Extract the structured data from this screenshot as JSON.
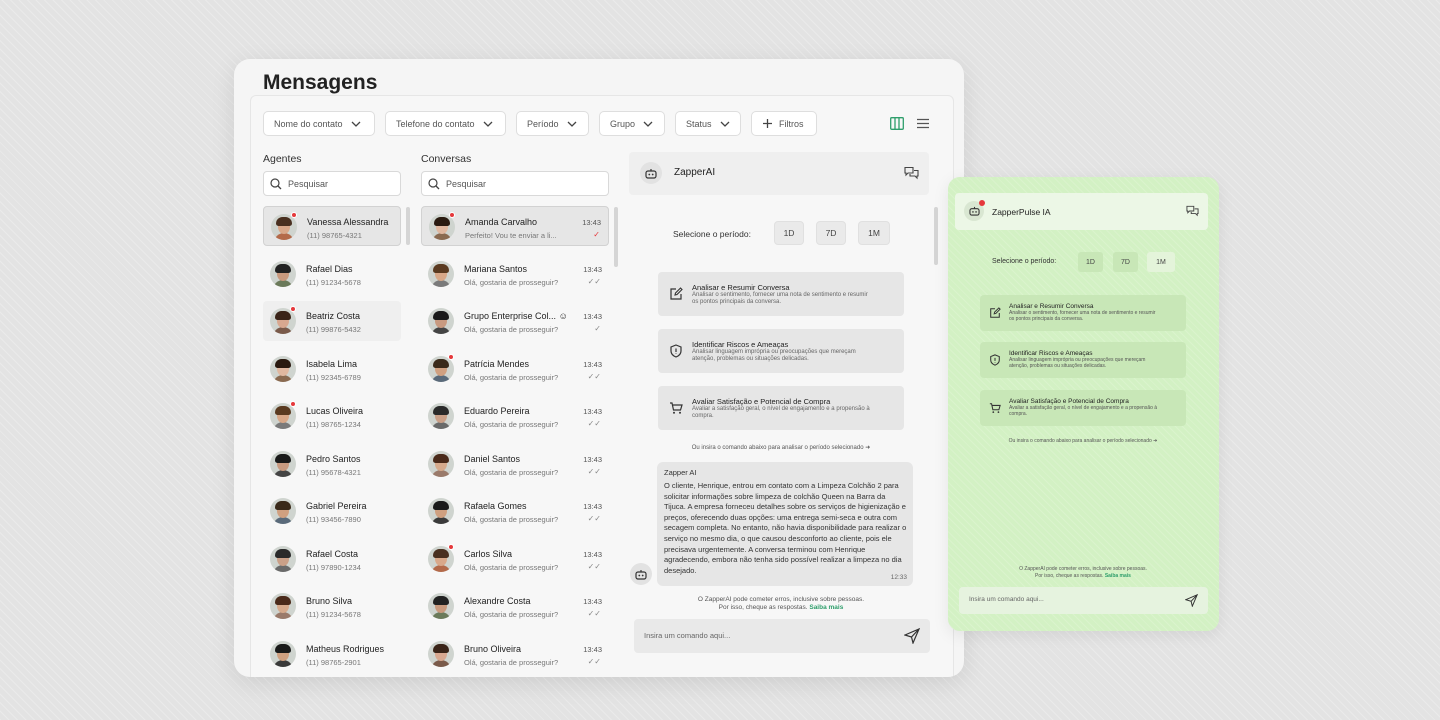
{
  "page_title": "Mensagens",
  "filters": [
    {
      "label": "Nome do contato"
    },
    {
      "label": "Telefone do contato"
    },
    {
      "label": "Período"
    },
    {
      "label": "Grupo"
    },
    {
      "label": "Status"
    }
  ],
  "filters_button": "Filtros",
  "agents": {
    "title": "Agentes",
    "search_placeholder": "Pesquisar",
    "items": [
      {
        "name": "Vanessa Alessandra",
        "phone": "(11) 98765-4321"
      },
      {
        "name": "Rafael Dias",
        "phone": "(11) 91234-5678"
      },
      {
        "name": "Beatriz Costa",
        "phone": "(11) 99876-5432"
      },
      {
        "name": "Isabela Lima",
        "phone": "(11) 92345-6789"
      },
      {
        "name": "Lucas Oliveira",
        "phone": "(11) 98765-1234"
      },
      {
        "name": "Pedro Santos",
        "phone": "(11) 95678-4321"
      },
      {
        "name": "Gabriel Pereira",
        "phone": "(11) 93456-7890"
      },
      {
        "name": "Rafael Costa",
        "phone": "(11) 97890-1234"
      },
      {
        "name": "Bruno Silva",
        "phone": "(11) 91234-5678"
      },
      {
        "name": "Matheus Rodrigues",
        "phone": "(11) 98765-2901"
      }
    ]
  },
  "conversations": {
    "title": "Conversas",
    "search_placeholder": "Pesquisar",
    "items": [
      {
        "name": "Amanda Carvalho",
        "preview": "Perfeito! Vou te enviar a li...",
        "time": "13:43"
      },
      {
        "name": "Mariana Santos",
        "preview": "Olá, gostaria de prosseguir?",
        "time": "13:43"
      },
      {
        "name": "Grupo Enterprise Col...",
        "preview": "Olá, gostaria de prosseguir?",
        "time": "13:43"
      },
      {
        "name": "Patrícia Mendes",
        "preview": "Olá, gostaria de prosseguir?",
        "time": "13:43"
      },
      {
        "name": "Eduardo Pereira",
        "preview": "Olá, gostaria de prosseguir?",
        "time": "13:43"
      },
      {
        "name": "Daniel Santos",
        "preview": "Olá, gostaria de prosseguir?",
        "time": "13:43"
      },
      {
        "name": "Rafaela Gomes",
        "preview": "Olá, gostaria de prosseguir?",
        "time": "13:43"
      },
      {
        "name": "Carlos Silva",
        "preview": "Olá, gostaria de prosseguir?",
        "time": "13:43"
      },
      {
        "name": "Alexandre Costa",
        "preview": "Olá, gostaria de prosseguir?",
        "time": "13:43"
      },
      {
        "name": "Bruno Oliveira",
        "preview": "Olá, gostaria de prosseguir?",
        "time": "13:43"
      }
    ]
  },
  "chat": {
    "title": "ZapperAI",
    "period_label": "Selecione o período:",
    "periods": [
      "1D",
      "7D",
      "1M"
    ],
    "actions": [
      {
        "title": "Analisar e Resumir Conversa",
        "desc": "Analisar o sentimento, fornecer uma nota de sentimento e resumir os pontos principais da conversa.",
        "icon": "edit-icon"
      },
      {
        "title": "Identificar Riscos e Ameaças",
        "desc": "Analisar linguagem imprópria ou preocupações que mereçam atenção, problemas ou situações delicadas.",
        "icon": "shield-icon"
      },
      {
        "title": "Avaliar Satisfação e Potencial de Compra",
        "desc": "Avaliar a satisfação geral, o nível de engajamento e a propensão à compra.",
        "icon": "cart-icon"
      }
    ],
    "hint": "Ou insira o comando abaixo para analisar o período selecionado",
    "message": {
      "sender": "Zapper AI",
      "text": "O cliente, Henrique, entrou em contato com a Limpeza Colchão 2 para solicitar informações sobre limpeza de colchão Queen na Barra da Tijuca. A empresa forneceu detalhes sobre os serviços de higienização e preços, oferecendo duas opções: uma entrega semi-seca e outra com secagem completa. No entanto, não havia disponibilidade para realizar o serviço no mesmo dia, o que causou desconforto ao cliente, pois ele precisava urgentemente. A conversa terminou com Henrique agradecendo, embora não tenha sido possível realizar a limpeza no dia desejado.",
      "time": "12:33"
    },
    "disclaimer_line1": "O ZapperAI pode cometer erros, inclusive sobre pessoas.",
    "disclaimer_line2": "Por isso, cheque as respostas.",
    "disclaimer_link": "Saiba mais",
    "input_placeholder": "Insira um comando aqui..."
  },
  "pulse": {
    "title": "ZapperPulse IA",
    "period_label": "Selecione o período:",
    "periods": [
      "1D",
      "7D",
      "1M"
    ],
    "hint": "Ou insira o comando abaixo para analisar o período selecionado",
    "disclaimer_line1": "O ZapperAI pode cometer erros, inclusive sobre pessoas.",
    "disclaimer_line2": "Por isso, cheque as respostas.",
    "disclaimer_link": "Saiba mais",
    "input_placeholder": "Insira um comando aqui..."
  },
  "colors": {
    "accent": "#2e9e6b",
    "notification": "#e5383b",
    "pulse_bg": "#d3f1c4"
  }
}
